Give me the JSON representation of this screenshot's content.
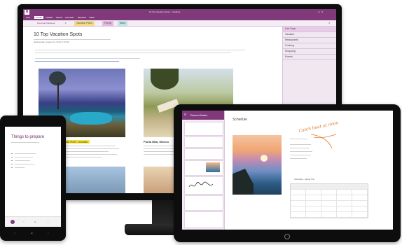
{
  "desktop": {
    "window_title": "10 Top Vacation Spots - OneNote",
    "active_ribbon_tab": "HOME",
    "ribbon_tabs": [
      "FILE",
      "HOME",
      "INSERT",
      "DRAW",
      "HISTORY",
      "REVIEW",
      "VIEW"
    ],
    "notebook": "Personal Notebook",
    "section_tabs": [
      "Vacation Plans",
      "Family",
      "Work"
    ],
    "page_title": "10 Top Vacation Spots",
    "page_meta": "Wednesday, August 14, 2013    5:13 PM",
    "highlight_label": "Ireland Reef, Vanuatu",
    "caption_2": "Punta Mita, Mexico",
    "sidebar_header": "Add Page",
    "sidebar_pages": [
      "Vacation",
      "Restaurants",
      "Cooking",
      "Shopping",
      "Events"
    ]
  },
  "tablet": {
    "app_title": "Recent Notes",
    "page_title": "Schedule",
    "handwriting": "Catch boat at noon",
    "table_title": "Schedule - Island Trip"
  },
  "phone": {
    "page_title": "Things to prepare"
  }
}
